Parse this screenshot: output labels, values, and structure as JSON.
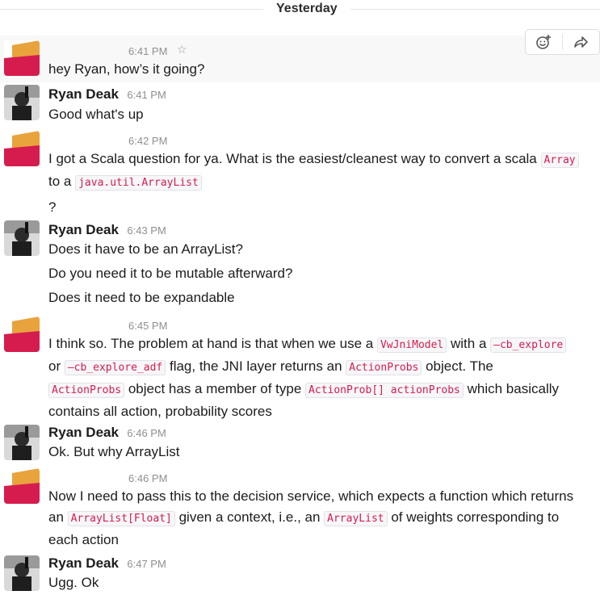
{
  "divider": {
    "label": "Yesterday"
  },
  "messages": [
    {
      "time": "6:41 PM",
      "text": "hey Ryan, how’s it going?"
    },
    {
      "author": "Ryan Deak",
      "time": "6:41 PM",
      "text": "Good what's up"
    },
    {
      "time": "6:42 PM",
      "line1a": "I got a Scala question for ya. What is the easiest/cleanest way to convert a scala ",
      "code1": "Array",
      "line2a": "to a ",
      "code2": "java.util.ArrayList",
      "line3": "?"
    },
    {
      "author": "Ryan Deak",
      "time": "6:43 PM",
      "line1": "Does it have to be an ArrayList?",
      "line2": "Do you need it to be mutable afterward?",
      "line3": "Does it need to be expandable"
    },
    {
      "time": "6:45 PM",
      "t1": "I think so. The problem at hand is that when we use a ",
      "c1": "VwJniModel",
      "t2": " with a ",
      "c2": "—cb_explore",
      "t3": "or ",
      "c3": "—cb_explore_adf",
      "t4": " flag, the JNI layer returns an ",
      "c4": "ActionProbs",
      "t5": " object. The",
      "c5": "ActionProbs",
      "t6": " object has a member of type ",
      "c6": "ActionProb[] actionProbs",
      "t7": " which basically",
      "t8": "contains all action, probability scores"
    },
    {
      "author": "Ryan Deak",
      "time": "6:46 PM",
      "text": "Ok. But why ArrayList"
    },
    {
      "time": "6:46 PM",
      "t1": "Now I need to pass this to the decision service, which expects a function which returns",
      "t2": "an ",
      "c1": "ArrayList[Float]",
      "t3": " given a context, i.e., an ",
      "c2": "ArrayList",
      "t4": " of weights corresponding to",
      "t5": "each action"
    },
    {
      "author": "Ryan Deak",
      "time": "6:47 PM",
      "text": "Ugg. Ok"
    }
  ],
  "colors": {
    "accent_orange": "#e8a33d",
    "accent_red": "#d61c4e",
    "mention_red": "#d61c4e"
  }
}
